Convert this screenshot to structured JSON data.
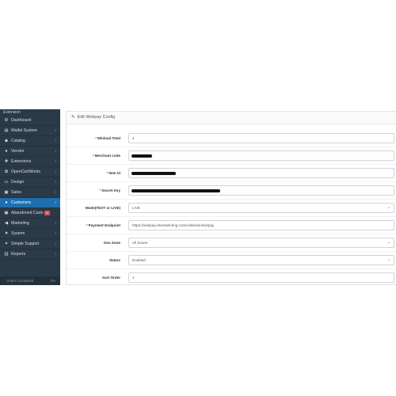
{
  "sidebar": {
    "top_label": "Extension",
    "items": [
      {
        "label": "Dashboard",
        "icon": "dashboard-icon",
        "glyph": "⚙",
        "chevron": false,
        "badge": ""
      },
      {
        "label": "Wallet System",
        "icon": "wallet-icon",
        "glyph": "▤",
        "chevron": true,
        "badge": ""
      },
      {
        "label": "Catalog",
        "icon": "tag-icon",
        "glyph": "◆",
        "chevron": true,
        "badge": ""
      },
      {
        "label": "Vendor",
        "icon": "users-icon",
        "glyph": "●",
        "chevron": true,
        "badge": ""
      },
      {
        "label": "Extensions",
        "icon": "puzzle-icon",
        "glyph": "✚",
        "chevron": true,
        "badge": ""
      },
      {
        "label": "OpenCartWorks",
        "icon": "cogs-icon",
        "glyph": "✿",
        "chevron": true,
        "badge": ""
      },
      {
        "label": "Design",
        "icon": "monitor-icon",
        "glyph": "▭",
        "chevron": true,
        "badge": ""
      },
      {
        "label": "Sales",
        "icon": "cart-icon",
        "glyph": "▣",
        "chevron": true,
        "badge": ""
      },
      {
        "label": "Customers",
        "icon": "user-icon",
        "glyph": "●",
        "chevron": true,
        "badge": "",
        "active": true
      },
      {
        "label": "Abandoned Carts",
        "icon": "cart-icon",
        "glyph": "▣",
        "chevron": false,
        "badge": "5"
      },
      {
        "label": "Marketing",
        "icon": "share-icon",
        "glyph": "◀",
        "chevron": true,
        "badge": ""
      },
      {
        "label": "System",
        "icon": "gear-icon",
        "glyph": "✷",
        "chevron": true,
        "badge": ""
      },
      {
        "label": "Simple Support",
        "icon": "support-icon",
        "glyph": "✦",
        "chevron": true,
        "badge": ""
      },
      {
        "label": "Reports",
        "icon": "bar-chart-icon",
        "glyph": "▥",
        "chevron": true,
        "badge": ""
      }
    ],
    "bottom": {
      "left": "Orders Completed",
      "right": "0%"
    },
    "colors": {
      "background": "#2b3a48",
      "active": "#1f6fb0"
    }
  },
  "panel": {
    "title": "Edit Webpay Config",
    "title_icon": "pencil-icon"
  },
  "form": {
    "fields": [
      {
        "label": "Minimal Total",
        "required": true,
        "type": "input",
        "value": "4",
        "redacted": false
      },
      {
        "label": "Merchant code",
        "required": true,
        "type": "input",
        "value": "",
        "redacted": true
      },
      {
        "label": "Item Id",
        "required": true,
        "type": "input",
        "value": "",
        "redacted": true
      },
      {
        "label": "Secret Key",
        "required": true,
        "type": "input",
        "value": "",
        "redacted": true
      },
      {
        "label": "Mode(TEST or LIVE)",
        "required": false,
        "type": "select",
        "value": "LIVE",
        "redacted": false
      },
      {
        "label": "Payment Endpoint",
        "required": true,
        "type": "input",
        "value": "https://webpay.interswitchng.com/collections/w/pay",
        "redacted": false
      },
      {
        "label": "Geo Zone",
        "required": false,
        "type": "select",
        "value": "All Zones",
        "redacted": false
      },
      {
        "label": "Status",
        "required": false,
        "type": "select",
        "value": "Enabled",
        "redacted": false
      },
      {
        "label": "Sort Order",
        "required": false,
        "type": "input",
        "value": "1",
        "redacted": false
      }
    ]
  }
}
